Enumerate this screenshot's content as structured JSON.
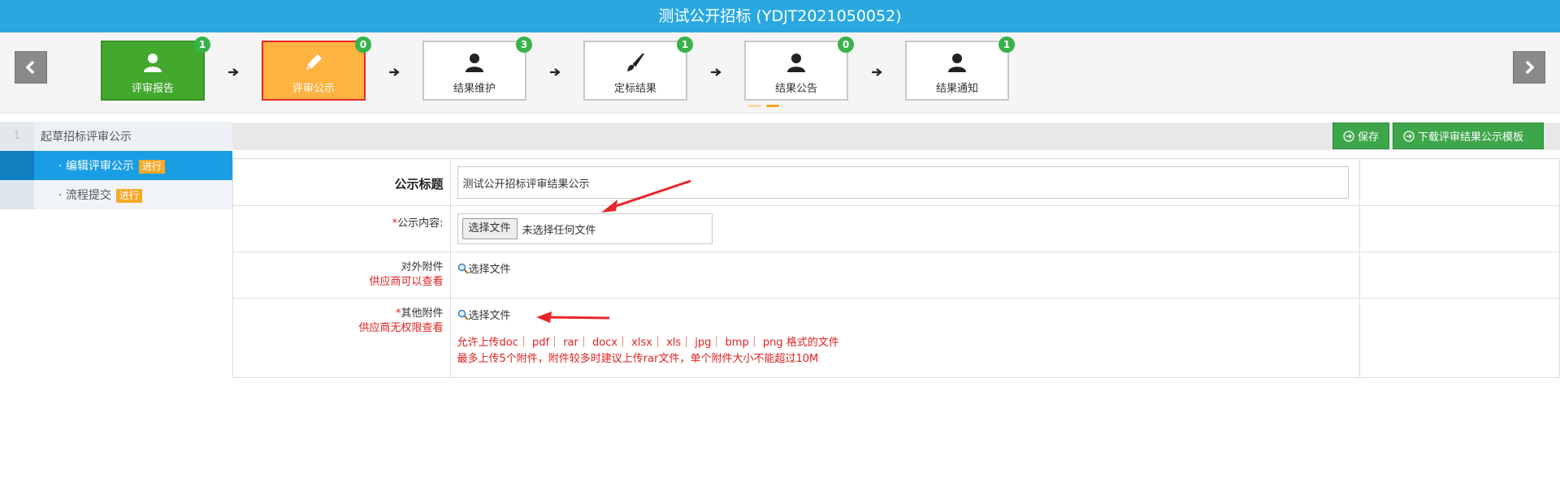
{
  "page_title": "测试公开招标 (YDJT2021050052)",
  "steps": [
    {
      "label": "评审报告",
      "badge": "1"
    },
    {
      "label": "评审公示",
      "badge": "0"
    },
    {
      "label": "结果维护",
      "badge": "3"
    },
    {
      "label": "定标结果",
      "badge": "1"
    },
    {
      "label": "结果公告",
      "badge": "0"
    },
    {
      "label": "结果通知",
      "badge": "1"
    }
  ],
  "menu": {
    "head_num": "1",
    "head_label": "起草招标评审公示",
    "items": [
      {
        "label": "· 编辑评审公示",
        "tag": "进行"
      },
      {
        "label": "· 流程提交",
        "tag": "进行"
      }
    ]
  },
  "toolbar": {
    "save_label": "保存",
    "download_label": "下载评审结果公示模板"
  },
  "form": {
    "title_label": "公示标题",
    "title_value": "测试公开招标评审结果公示",
    "content_required": "*",
    "content_label": "公示内容:",
    "file_button": "选择文件",
    "file_status": "未选择任何文件",
    "external_label": "对外附件",
    "external_note": "供应商可以查看",
    "external_select": "选择文件",
    "other_required": "*",
    "other_label": "其他附件",
    "other_note": "供应商无权限查看",
    "other_select": "选择文件",
    "hint_line1": "允许上传doc｜ pdf｜ rar｜ docx｜ xlsx｜ xls｜ jpg｜ bmp｜ png 格式的文件",
    "hint_line2": "最多上传5个附件，附件较多时建议上传rar文件，单个附件大小不能超过10M"
  },
  "colors": {
    "header": "#29a8e0",
    "step_done": "#43a82e",
    "step_active": "#ffb341",
    "badge": "#37b34a",
    "menu_selected": "#1a9ee3",
    "tag": "#f7a928",
    "button": "#3da64a",
    "annotation_arrow": "#e8262a"
  }
}
